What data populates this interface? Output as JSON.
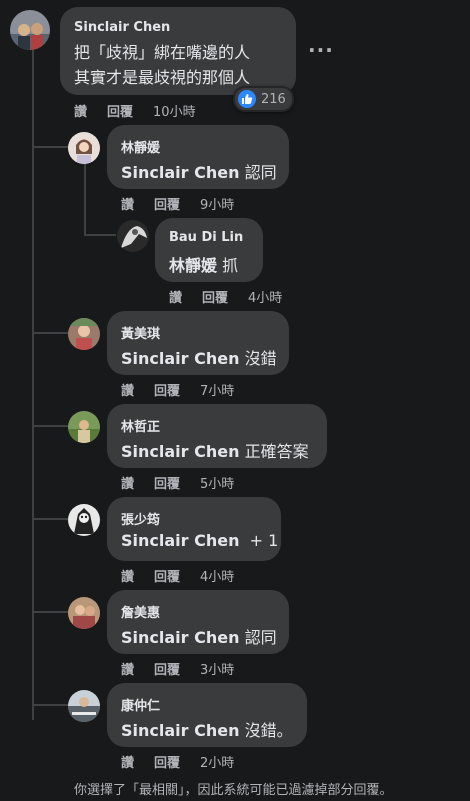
{
  "main_comment": {
    "author": "Sinclair Chen",
    "line1": "把「歧視」綁在嘴邊的人",
    "line2": "其實才是最歧視的那個人",
    "like_label": "讚",
    "reply_label": "回覆",
    "time": "10小時",
    "reaction_count": "216",
    "more_icon": "more-options-icon"
  },
  "replies": [
    {
      "author": "林靜媛",
      "mention": "Sinclair Chen",
      "text": " 認同",
      "like_label": "讚",
      "reply_label": "回覆",
      "time": "9小時"
    },
    {
      "author": "Bau Di Lin",
      "mention": "林靜媛",
      "text": " 抓",
      "like_label": "讚",
      "reply_label": "回覆",
      "time": "4小時"
    },
    {
      "author": "黃美琪",
      "mention": "Sinclair Chen",
      "text": " 沒錯",
      "like_label": "讚",
      "reply_label": "回覆",
      "time": "7小時"
    },
    {
      "author": "林哲正",
      "mention": "Sinclair Chen",
      "text": " 正確答案",
      "like_label": "讚",
      "reply_label": "回覆",
      "time": "5小時"
    },
    {
      "author": "張少筠",
      "mention": "Sinclair Chen",
      "text": "  + 1",
      "like_label": "讚",
      "reply_label": "回覆",
      "time": "4小時"
    },
    {
      "author": "詹美惠",
      "mention": "Sinclair Chen",
      "text": " 認同",
      "like_label": "讚",
      "reply_label": "回覆",
      "time": "3小時"
    },
    {
      "author": "康仲仁",
      "mention": "Sinclair Chen",
      "text": " 沒錯。",
      "like_label": "讚",
      "reply_label": "回覆",
      "time": "2小時"
    }
  ],
  "footer_note": "你選擇了「最相關」，因此系統可能已過濾掉部分回覆。",
  "colors": {
    "background": "#18191a",
    "bubble": "#3a3b3c",
    "text": "#e4e6eb",
    "secondary": "#b0b3b8",
    "like_blue": "#2d88ff"
  }
}
